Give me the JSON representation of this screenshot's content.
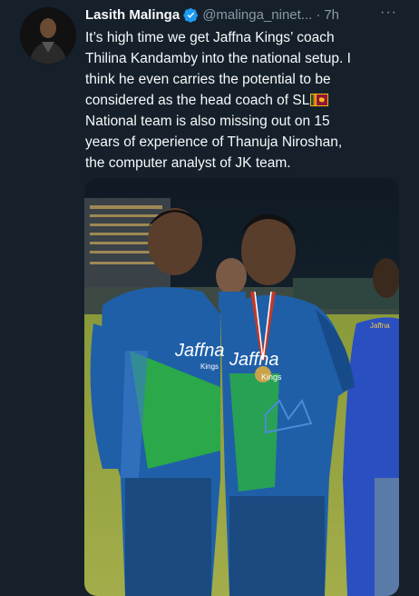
{
  "author": {
    "name": "Lasith Malinga",
    "handle": "@malinga_ninet...",
    "separator": "·",
    "time": "7h",
    "verified_icon": "verified-badge-icon",
    "avatar_icon": "profile-avatar"
  },
  "more_label": "···",
  "tweet": {
    "lines": [
      "It’s high time we get Jaffna Kings’ coach",
      "Thilina Kandamby into the national setup. I",
      "think he even carries the potential to be",
      "considered as the head coach of SL",
      "National team is also missing out on 15",
      "years of experience of Thanuja Niroshan,",
      "the computer analyst of JK team."
    ],
    "flag_icon": "sri-lanka-flag-icon"
  },
  "media": {
    "jersey_text_left": "Jaffna",
    "jersey_sub_left": "Kings",
    "jersey_text_right": "Jaffna",
    "jersey_sub_right": "Kings",
    "bg_jersey_text": "Jaffna"
  },
  "colors": {
    "background": "#15202b",
    "text": "#f7f9f9",
    "muted": "#8b98a5",
    "verified": "#1d9bf0",
    "jersey_blue": "#1f5fa8",
    "jersey_green": "#2aa84a"
  }
}
